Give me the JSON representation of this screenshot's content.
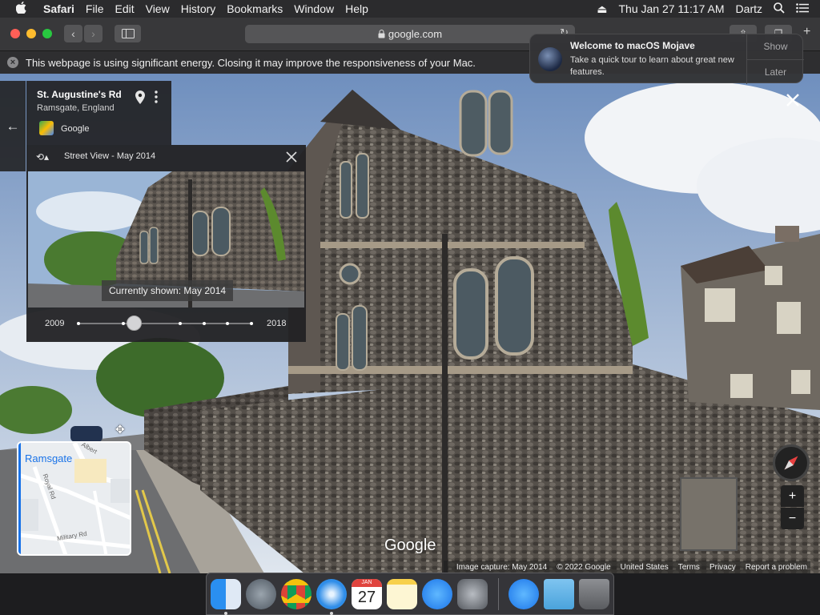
{
  "menubar": {
    "apple_icon": "apple-logo-icon",
    "app_name": "Safari",
    "items": [
      "File",
      "Edit",
      "View",
      "History",
      "Bookmarks",
      "Window",
      "Help"
    ],
    "datetime": "Thu Jan 27  11:17 AM",
    "user": "Dartz"
  },
  "toolbar": {
    "url": "google.com"
  },
  "energy_warning": {
    "text": "This webpage is using significant energy. Closing it may improve the responsiveness of your Mac."
  },
  "notification": {
    "title": "Welcome to macOS Mojave",
    "body": "Take a quick tour to learn about great new features.",
    "show_label": "Show",
    "later_label": "Later"
  },
  "address_card": {
    "street": "St. Augustine's Rd",
    "locality": "Ramsgate, England",
    "source": "Google"
  },
  "time_machine": {
    "title": "Street View - May 2014",
    "current_label": "Currently shown: May 2014",
    "start_year": "2009",
    "end_year": "2018",
    "selected_fraction": 0.32
  },
  "minimap": {
    "town": "Ramsgate",
    "street_labels": [
      "Royal Rd",
      "Military Rd",
      "Albert"
    ]
  },
  "watermark": "Google",
  "credits": {
    "capture": "Image capture: May 2014",
    "copyright": "© 2022 Google",
    "region": "United States",
    "terms": "Terms",
    "privacy": "Privacy",
    "report": "Report a problem"
  },
  "calendar": {
    "month": "JAN",
    "day": "27"
  },
  "colors": {
    "close": "#ff5f57",
    "minimize": "#febc2e",
    "zoom": "#28c840"
  }
}
